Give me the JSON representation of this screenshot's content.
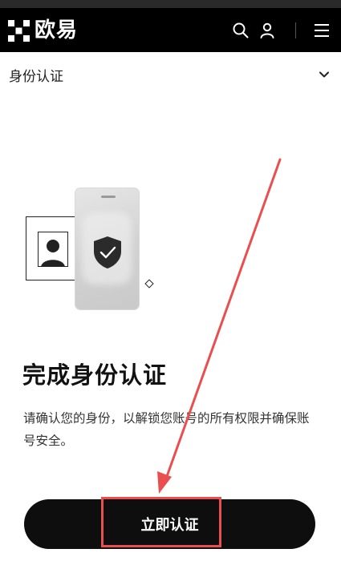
{
  "header": {
    "brand_name": "欧易",
    "logo_icon": "okx-logo-icon",
    "search_icon": "search-icon",
    "account_icon": "user-icon",
    "menu_icon": "hamburger-menu-icon"
  },
  "section": {
    "title": "身份认证",
    "toggle_icon": "chevron-down-icon"
  },
  "main": {
    "heading": "完成身份认证",
    "description": "请确认您的身份，以解锁您账号的所有权限并确保账号安全。",
    "cta_label": "立即认证"
  },
  "annotations": {
    "highlight_color": "#e94f4f",
    "arrow_color": "#e94f4f"
  },
  "colors": {
    "topbar": "#000000",
    "button": "#0e0e0e",
    "background": "#ffffff"
  }
}
